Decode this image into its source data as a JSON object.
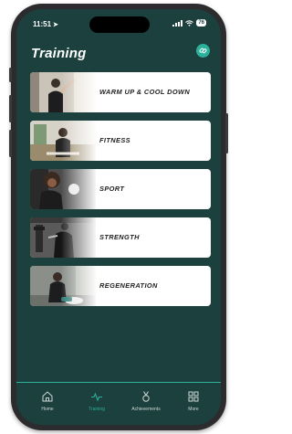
{
  "status_bar": {
    "time": "11:51",
    "battery": "76"
  },
  "header": {
    "title": "Training",
    "action_icon": "link-icon"
  },
  "categories": [
    {
      "label": "WARM UP & COOL DOWN"
    },
    {
      "label": "FITNESS"
    },
    {
      "label": "SPORT"
    },
    {
      "label": "STRENGTH"
    },
    {
      "label": "REGENERATION"
    }
  ],
  "tabbar": {
    "items": [
      {
        "label": "Home",
        "icon": "home-icon"
      },
      {
        "label": "Training",
        "icon": "pulse-icon",
        "active": true
      },
      {
        "label": "Achievements",
        "icon": "medal-icon"
      },
      {
        "label": "More",
        "icon": "grid-icon"
      }
    ]
  },
  "colors": {
    "background": "#1b403d",
    "accent": "#2bb09a",
    "card": "#ffffff"
  }
}
